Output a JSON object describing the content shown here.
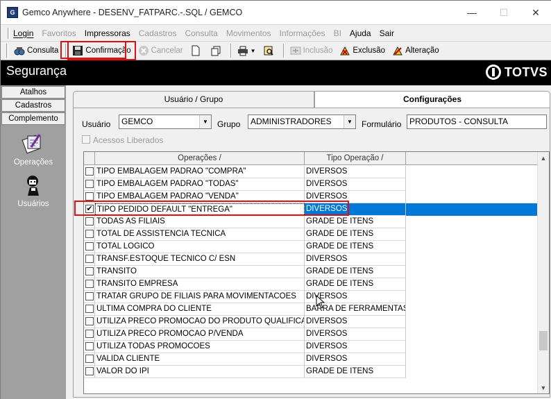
{
  "window": {
    "title": "Gemco Anywhere - DESENV_FATPARC.-.SQL / GEMCO",
    "buttons": {
      "minimize": "—",
      "maximize": "☐",
      "close": "✕"
    }
  },
  "menu": {
    "items": [
      {
        "label": "Login",
        "enabled": true
      },
      {
        "label": "Favoritos",
        "enabled": false
      },
      {
        "label": "Impressoras",
        "enabled": true
      },
      {
        "label": "Cadastros",
        "enabled": false
      },
      {
        "label": "Consulta",
        "enabled": false
      },
      {
        "label": "Movimentos",
        "enabled": false
      },
      {
        "label": "Informações",
        "enabled": false
      },
      {
        "label": "BI",
        "enabled": false
      },
      {
        "label": "Ajuda",
        "enabled": true
      },
      {
        "label": "Sair",
        "enabled": true
      }
    ]
  },
  "toolbar": {
    "consulta": "Consulta",
    "confirmacao": "Confirmação",
    "cancelar": "Cancelar",
    "inclusao": "Inclusão",
    "exclusao": "Exclusão",
    "alteracao": "Alteração"
  },
  "header": {
    "title": "Segurança",
    "logo": "TOTVS"
  },
  "sidebar": {
    "buttons": [
      "Atalhos",
      "Cadastros",
      "Complemento"
    ],
    "items": [
      "Operações",
      "Usuários"
    ]
  },
  "tabs": {
    "tab1": "Usuário  / Grupo",
    "tab2": "Configurações"
  },
  "filters": {
    "usuario_label": "Usuário",
    "usuario_value": "GEMCO",
    "grupo_label": "Grupo",
    "grupo_value": "ADMINISTRADORES",
    "formulario_label": "Formulário",
    "formulario_value": "PRODUTOS - CONSULTA",
    "acessos_label": "Acessos Liberados"
  },
  "grid": {
    "columns": [
      "Operações  /",
      "Tipo Operação  /"
    ],
    "rows": [
      {
        "op": "TIPO EMBALAGEM PADRAO \"COMPRA\"",
        "tipo": "DIVERSOS",
        "checked": false
      },
      {
        "op": "TIPO EMBALAGEM PADRAO \"TODAS\"",
        "tipo": "DIVERSOS",
        "checked": false
      },
      {
        "op": "TIPO EMBALAGEM PADRAO \"VENDA\"",
        "tipo": "DIVERSOS",
        "checked": false
      },
      {
        "op": "TIPO PEDIDO DEFAULT \"ENTREGA\"",
        "tipo": "DIVERSOS",
        "checked": true
      },
      {
        "op": "TODAS AS FILIAIS",
        "tipo": "GRADE DE ITENS",
        "checked": false
      },
      {
        "op": "TOTAL DE ASSISTENCIA TECNICA",
        "tipo": "GRADE DE ITENS",
        "checked": false
      },
      {
        "op": "TOTAL LOGICO",
        "tipo": "GRADE DE ITENS",
        "checked": false
      },
      {
        "op": "TRANSF.ESTOQUE TECNICO C/ ESN",
        "tipo": "DIVERSOS",
        "checked": false
      },
      {
        "op": "TRANSITO",
        "tipo": "GRADE DE ITENS",
        "checked": false
      },
      {
        "op": "TRANSITO EMPRESA",
        "tipo": "GRADE DE ITENS",
        "checked": false
      },
      {
        "op": "TRATAR GRUPO DE FILIAIS PARA MOVIMENTACOES",
        "tipo": "DIVERSOS",
        "checked": false
      },
      {
        "op": "ULTIMA COMPRA DO CLIENTE",
        "tipo": "BARRA DE FERRAMENTAS",
        "checked": false
      },
      {
        "op": "UTILIZA PRECO PROMOCAO DO PRODUTO QUALIFICADO",
        "tipo": "DIVERSOS",
        "checked": false
      },
      {
        "op": "UTILIZA PRECO PROMOCAO P/VENDA",
        "tipo": "DIVERSOS",
        "checked": false
      },
      {
        "op": "UTILIZA TODAS PROMOCOES",
        "tipo": "DIVERSOS",
        "checked": false
      },
      {
        "op": "VALIDA CLIENTE",
        "tipo": "DIVERSOS",
        "checked": false
      },
      {
        "op": "VALOR DO IPI",
        "tipo": "GRADE DE ITENS",
        "checked": false
      }
    ],
    "selected_index": 3
  },
  "colors": {
    "selection": "#0078d7",
    "highlight_box": "#e01010",
    "header_bg": "#000000"
  }
}
